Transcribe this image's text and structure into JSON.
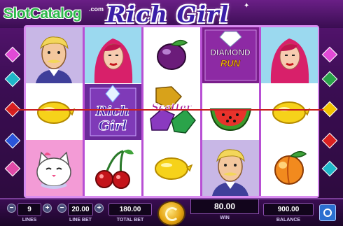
{
  "header": {
    "watermark_left": "SlotCatalog",
    "watermark_suffix": ".com",
    "title": "Rich Girl"
  },
  "reels": [
    [
      "old-man",
      "lemon",
      "cat"
    ],
    [
      "girl",
      "rich-girl",
      "cherries"
    ],
    [
      "plum",
      "scatter",
      "lemon"
    ],
    [
      "diamond-run",
      "watermelon",
      "old-man"
    ],
    [
      "girl",
      "lemon",
      "peach"
    ]
  ],
  "symbols": {
    "rich_girl_text_1": "Rich",
    "rich_girl_text_2": "Girl",
    "scatter_text": "Scatter",
    "diamond_run_text_1": "DIAMOND",
    "diamond_run_text_2": "RUN"
  },
  "side_gems": {
    "left_colors": [
      "#e14ad6",
      "#1fb7c9",
      "#d92020",
      "#2a55d9",
      "#e04aa8"
    ],
    "right_colors": [
      "#e14ad6",
      "#2aa34a",
      "#f2c200",
      "#d92020",
      "#1fb7c9"
    ]
  },
  "win_line_color": "#c81f1f",
  "controls": {
    "lines": {
      "label": "LINES",
      "value": "9"
    },
    "line_bet": {
      "label": "LINE BET",
      "value": "20.00"
    },
    "total_bet": {
      "label": "TOTAL BET",
      "value": "180.00"
    },
    "win": {
      "label": "WIN",
      "value": "80.00"
    },
    "balance": {
      "label": "BALANCE",
      "value": "900.00"
    },
    "minus_symbol": "−",
    "plus_symbol": "+"
  },
  "icons": {
    "spin": "spin-arrow-icon",
    "settings": "settings-gear-icon"
  }
}
